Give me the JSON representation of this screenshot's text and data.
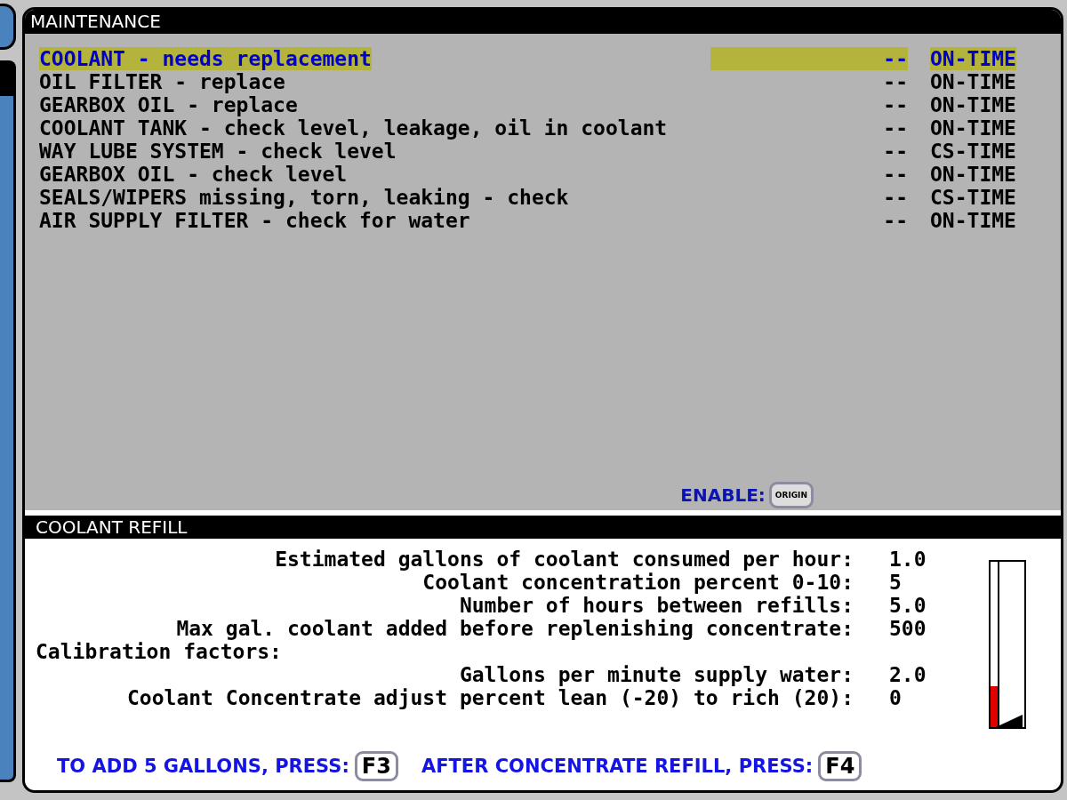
{
  "maintenance": {
    "title": "MAINTENANCE",
    "items": [
      {
        "task": "COOLANT - needs replacement",
        "due": "--",
        "status": "ON-TIME",
        "selected": true
      },
      {
        "task": "OIL FILTER - replace",
        "due": "--",
        "status": "ON-TIME",
        "selected": false
      },
      {
        "task": "GEARBOX OIL - replace",
        "due": "--",
        "status": "ON-TIME",
        "selected": false
      },
      {
        "task": "COOLANT TANK - check level, leakage, oil in coolant",
        "due": "--",
        "status": "ON-TIME",
        "selected": false
      },
      {
        "task": "WAY LUBE SYSTEM - check level",
        "due": "--",
        "status": "CS-TIME",
        "selected": false
      },
      {
        "task": "GEARBOX OIL - check level",
        "due": "--",
        "status": "ON-TIME",
        "selected": false
      },
      {
        "task": "SEALS/WIPERS missing, torn, leaking - check",
        "due": "--",
        "status": "CS-TIME",
        "selected": false
      },
      {
        "task": "AIR SUPPLY FILTER - check for water",
        "due": "--",
        "status": "ON-TIME",
        "selected": false
      }
    ],
    "enable_label": "ENABLE:",
    "enable_key": "ORIGIN"
  },
  "coolant_refill": {
    "title": "COOLANT REFILL",
    "rows": [
      {
        "kind": "setting",
        "label": "Estimated gallons of coolant consumed per hour:",
        "value": "1.0"
      },
      {
        "kind": "setting",
        "label": "Coolant concentration percent 0-10:",
        "value": "5"
      },
      {
        "kind": "setting",
        "label": "Number of hours between refills:",
        "value": "5.0"
      },
      {
        "kind": "setting",
        "label": "Max gal. coolant added before replenishing concentrate:",
        "value": "500"
      },
      {
        "kind": "heading",
        "label": "Calibration factors:"
      },
      {
        "kind": "setting",
        "label": "Gallons per minute supply water:",
        "value": "2.0"
      },
      {
        "kind": "setting",
        "label": "Coolant Concentrate adjust percent lean (-20) to rich (20):",
        "value": "0"
      }
    ],
    "gauge": {
      "level": 0.25
    },
    "add_prompt": "TO ADD 5 GALLONS, PRESS:",
    "add_key": "F3",
    "refill_prompt": "AFTER CONCENTRATE REFILL, PRESS:",
    "refill_key": "F4"
  }
}
